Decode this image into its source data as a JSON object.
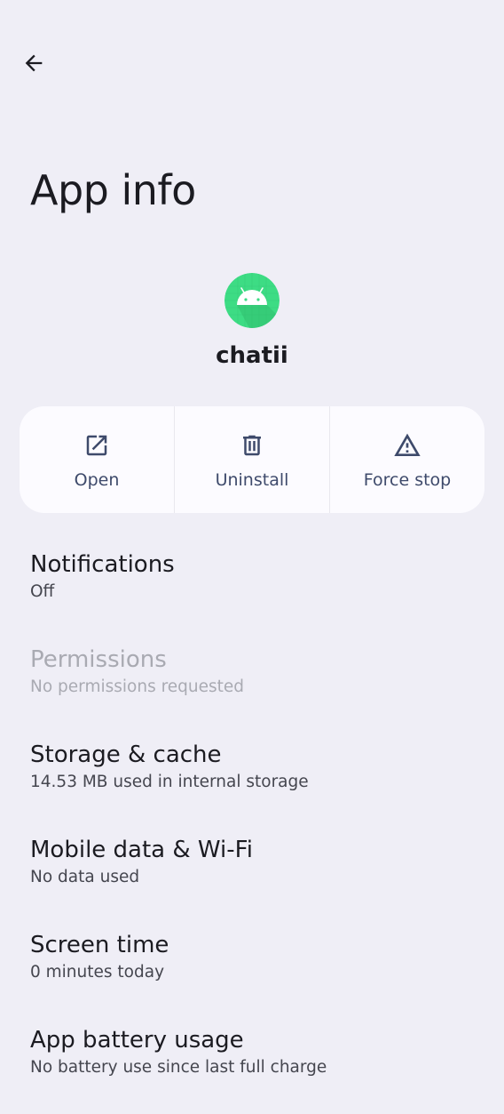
{
  "header": {
    "back_icon": "arrow-back-icon",
    "title": "App info"
  },
  "app": {
    "icon": "android-app-icon",
    "name": "chatii",
    "icon_colors": {
      "background": "#3DDC84",
      "robot": "#FFFFFF"
    }
  },
  "actions": [
    {
      "icon": "open-external-icon",
      "label": "Open"
    },
    {
      "icon": "trash-icon",
      "label": "Uninstall"
    },
    {
      "icon": "warning-triangle-icon",
      "label": "Force stop"
    }
  ],
  "settings": [
    {
      "title": "Notifications",
      "summary": "Off",
      "enabled": true
    },
    {
      "title": "Permissions",
      "summary": "No permissions requested",
      "enabled": false
    },
    {
      "title": "Storage & cache",
      "summary": "14.53 MB used in internal storage",
      "enabled": true
    },
    {
      "title": "Mobile data & Wi-Fi",
      "summary": "No data used",
      "enabled": true
    },
    {
      "title": "Screen time",
      "summary": "0 minutes today",
      "enabled": true
    },
    {
      "title": "App battery usage",
      "summary": "No battery use since last full charge",
      "enabled": true
    }
  ],
  "colors": {
    "background": "#EFEEF6",
    "card": "#FCFBFF",
    "accent": "#3E4A6B",
    "text_primary": "#1B1B21",
    "text_secondary": "#45464F",
    "text_disabled": "#A9AAB2"
  }
}
